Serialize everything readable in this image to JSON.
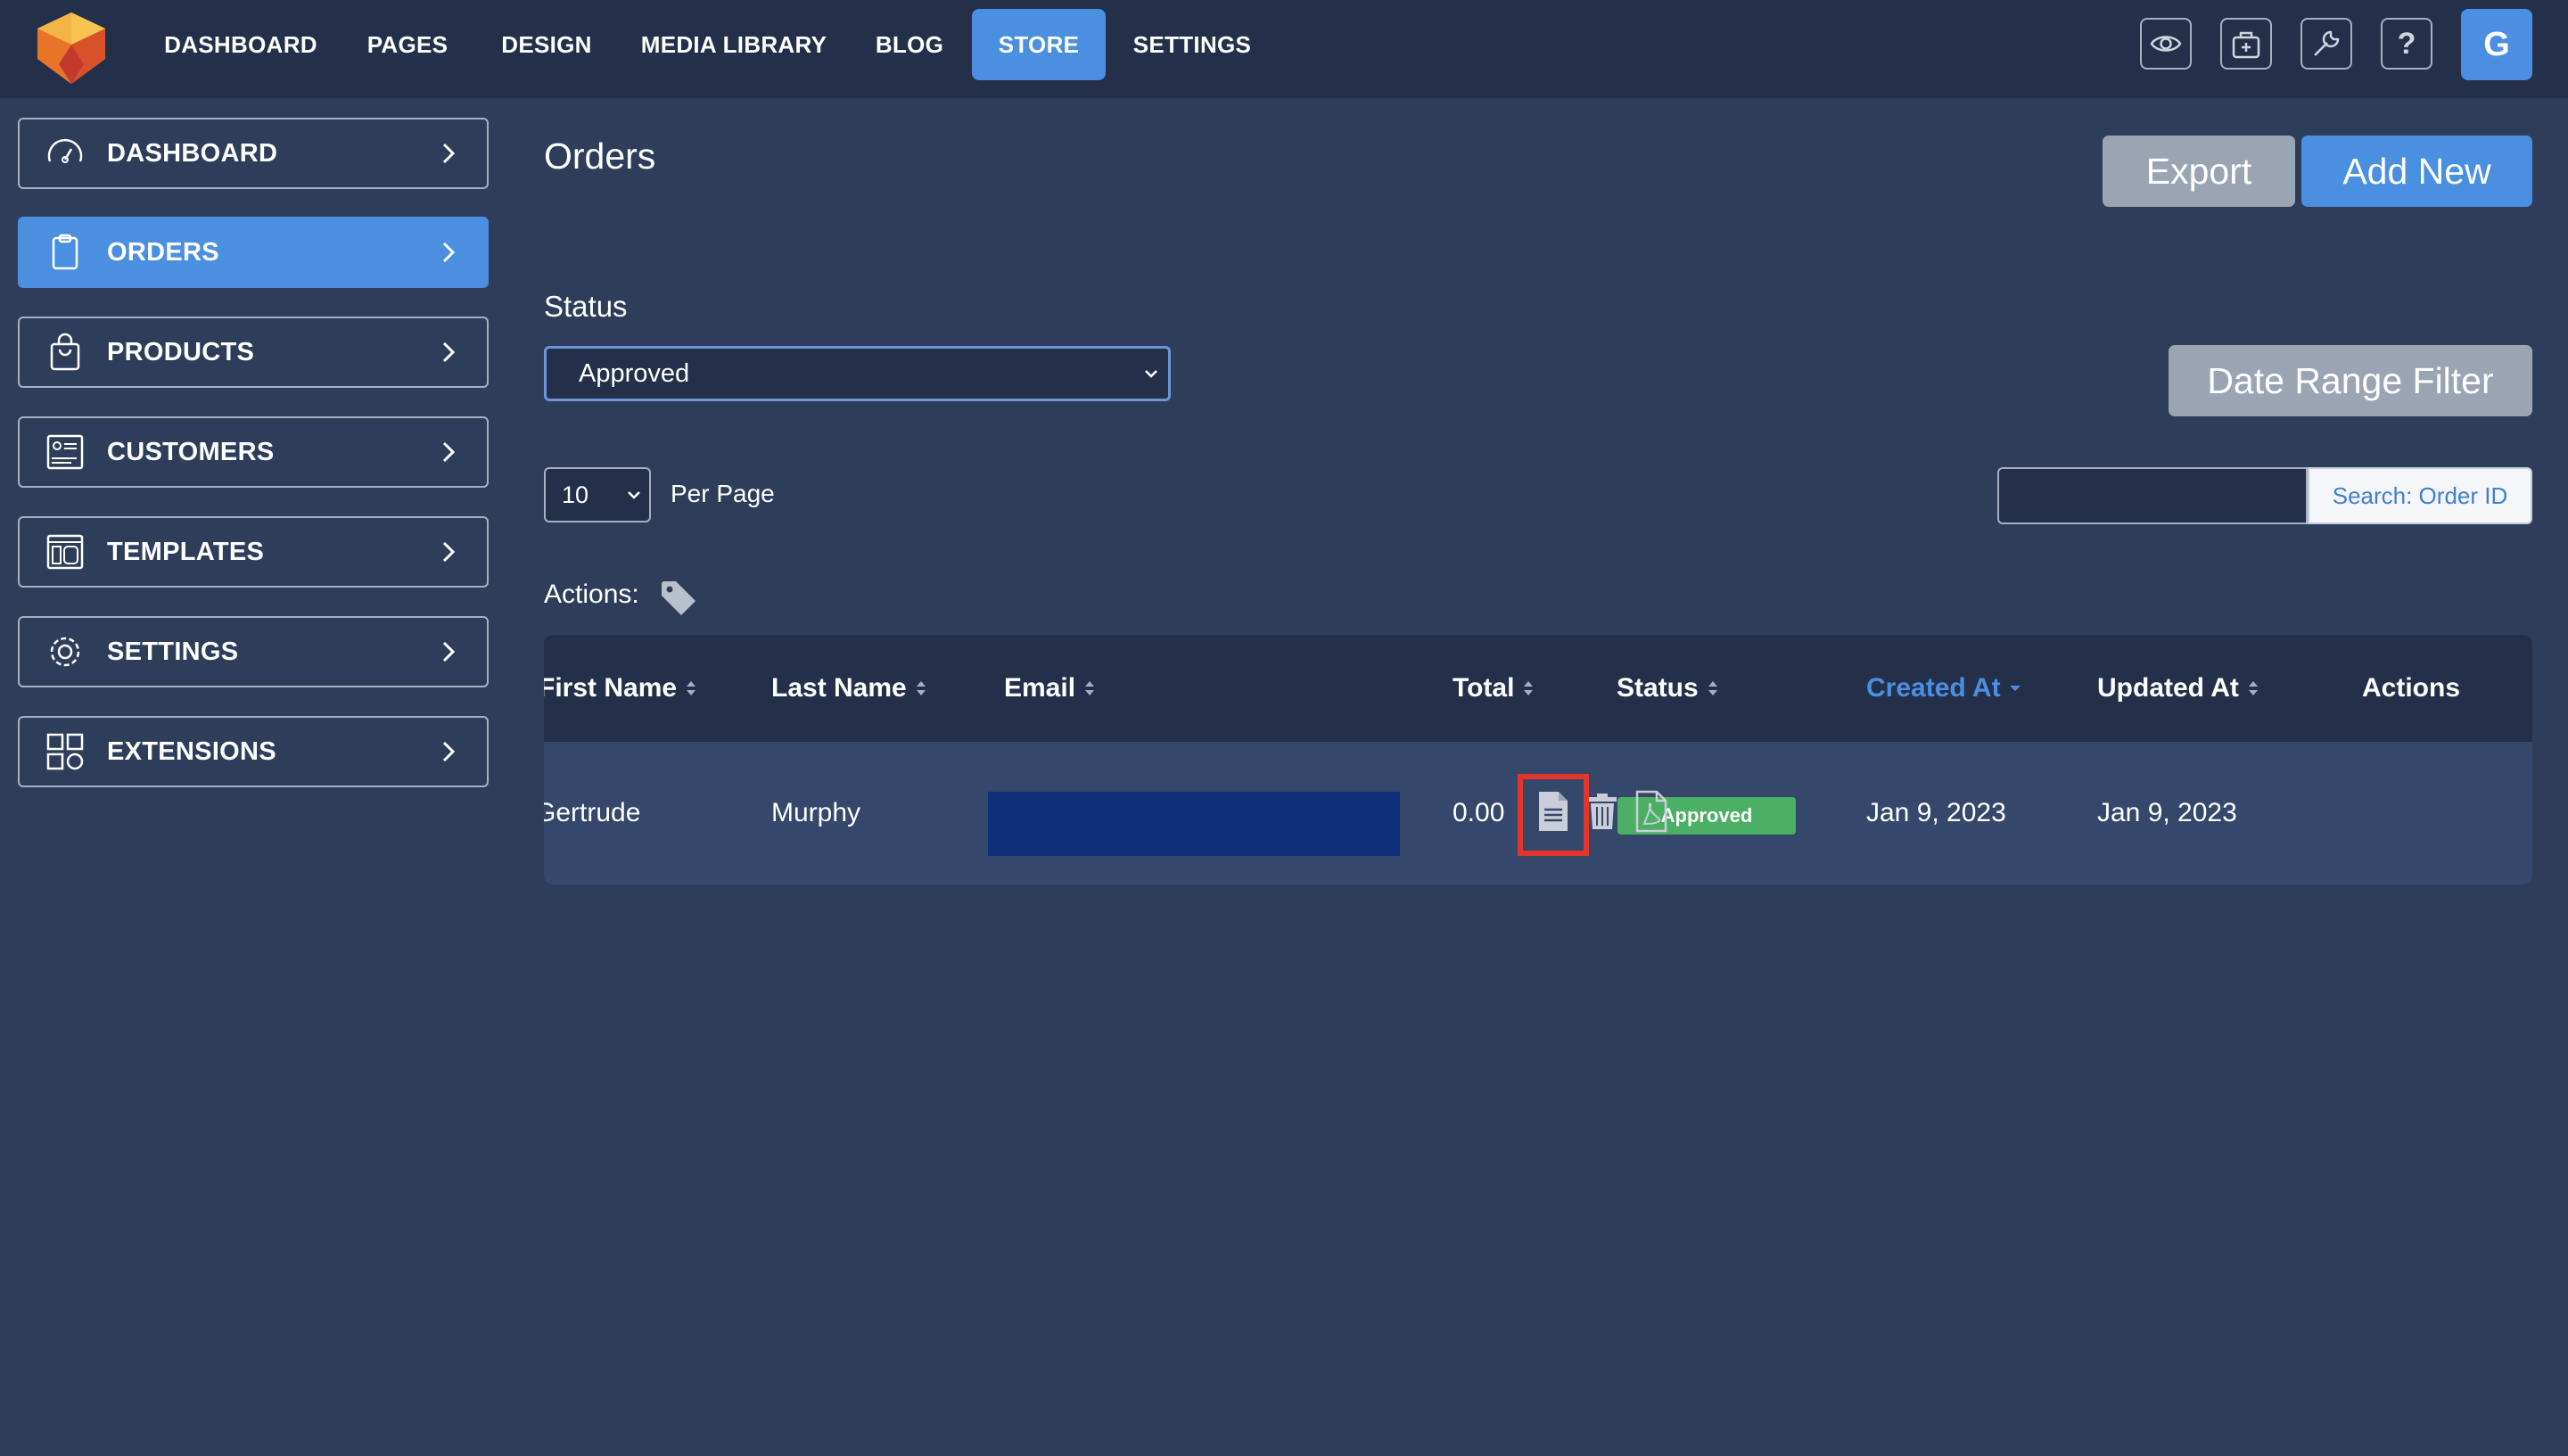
{
  "nav": {
    "items": [
      {
        "label": "DASHBOARD",
        "active": false
      },
      {
        "label": "PAGES",
        "active": false
      },
      {
        "label": "DESIGN",
        "active": false
      },
      {
        "label": "MEDIA LIBRARY",
        "active": false
      },
      {
        "label": "BLOG",
        "active": false
      },
      {
        "label": "STORE",
        "active": true
      },
      {
        "label": "SETTINGS",
        "active": false
      }
    ],
    "icons": [
      "eye-icon",
      "store-icon",
      "wrench-icon",
      "help-icon"
    ],
    "help_glyph": "?",
    "avatar_letter": "G"
  },
  "sidebar": {
    "items": [
      {
        "label": "DASHBOARD",
        "icon": "gauge-icon",
        "active": false
      },
      {
        "label": "ORDERS",
        "icon": "clipboard-icon",
        "active": true
      },
      {
        "label": "PRODUCTS",
        "icon": "shopping-bag-icon",
        "active": false
      },
      {
        "label": "CUSTOMERS",
        "icon": "contact-list-icon",
        "active": false
      },
      {
        "label": "TEMPLATES",
        "icon": "template-icon",
        "active": false
      },
      {
        "label": "SETTINGS",
        "icon": "gear-icon",
        "active": false
      },
      {
        "label": "EXTENSIONS",
        "icon": "grid-shapes-icon",
        "active": false
      }
    ]
  },
  "main": {
    "title": "Orders",
    "export_label": "Export",
    "add_new_label": "Add New",
    "status_label": "Status",
    "status_value": "Approved",
    "date_range_label": "Date Range Filter",
    "per_page_value": "10",
    "per_page_label": "Per Page",
    "search_value": "",
    "search_button_label": "Search: Order ID",
    "actions_label": "Actions:"
  },
  "table": {
    "columns": [
      "First Name",
      "Last Name",
      "Email",
      "Total",
      "Status",
      "Created At",
      "Updated At",
      "Actions"
    ],
    "sorted_column": "Created At",
    "rows": [
      {
        "first_name": "Gertrude",
        "last_name": "Murphy",
        "email": "",
        "total": "0.00",
        "status": "Approved",
        "created_at": "Jan 9, 2023",
        "updated_at": "Jan 9, 2023"
      }
    ],
    "row_action_icons": [
      "document-icon",
      "trash-icon",
      "pdf-icon"
    ]
  },
  "colors": {
    "background": "#2e3e5a",
    "topbar": "#24304a",
    "accent": "#4a8fe0",
    "approved": "#4caf66",
    "highlight": "#e2352b"
  }
}
